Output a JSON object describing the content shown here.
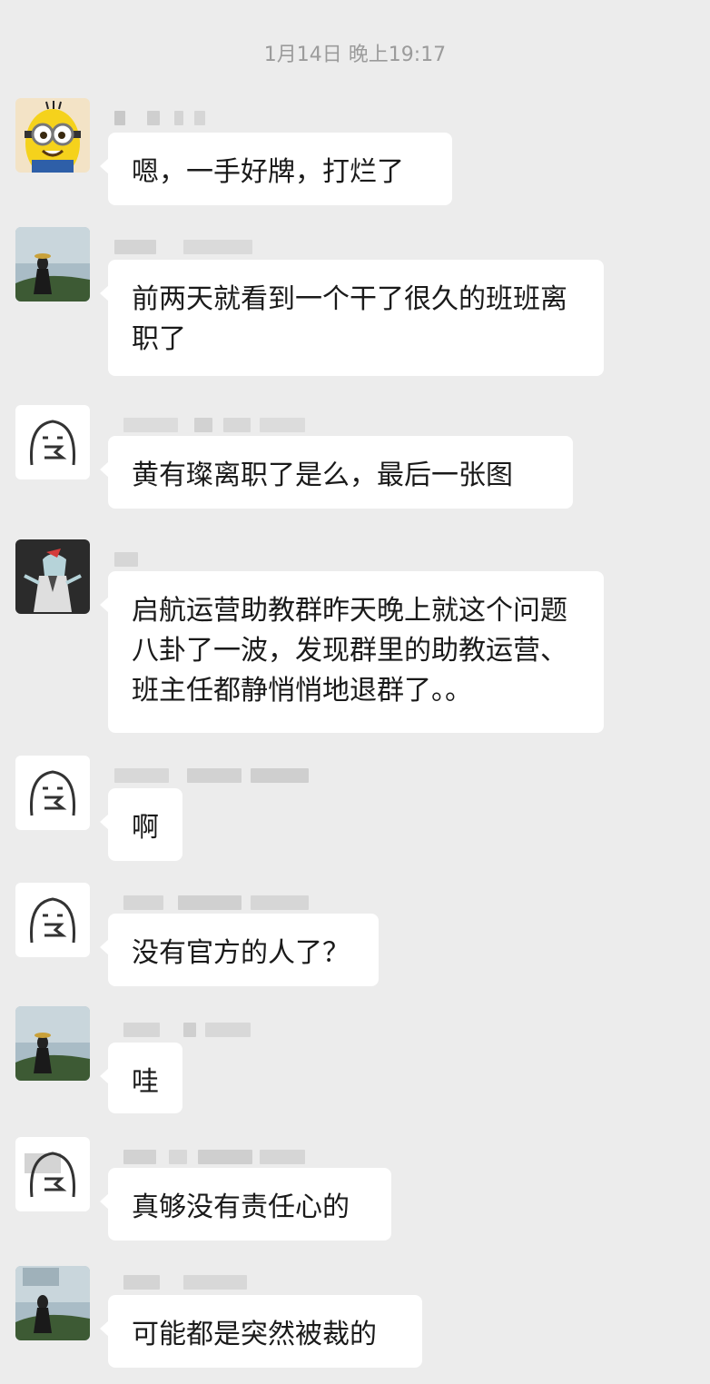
{
  "chat": {
    "timestamp": "1月14日 晚上19:17",
    "messages": [
      {
        "avatar": "minion-avatar",
        "text": "嗯，一手好牌，打烂了"
      },
      {
        "avatar": "landscape-avatar",
        "text": "前两天就看到一个干了很久的班班离职了"
      },
      {
        "avatar": "doodle-face-avatar",
        "text": "黄有璨离职了是么，最后一张图"
      },
      {
        "avatar": "cartoon-character-avatar",
        "text": "启航运营助教群昨天晚上就这个问题八卦了一波，发现群里的助教运营、班主任都静悄悄地退群了。。"
      },
      {
        "avatar": "doodle-face-avatar",
        "text": "啊"
      },
      {
        "avatar": "doodle-face-avatar",
        "text": "没有官方的人了？"
      },
      {
        "avatar": "landscape-avatar",
        "text": "哇"
      },
      {
        "avatar": "doodle-face-avatar",
        "text": "真够没有责任心的"
      },
      {
        "avatar": "landscape-avatar",
        "text": "可能都是突然被裁的"
      }
    ]
  },
  "colors": {
    "background": "#ececec",
    "bubble": "#ffffff",
    "text": "#1a1a1a",
    "timestamp": "#9b9b9b"
  }
}
